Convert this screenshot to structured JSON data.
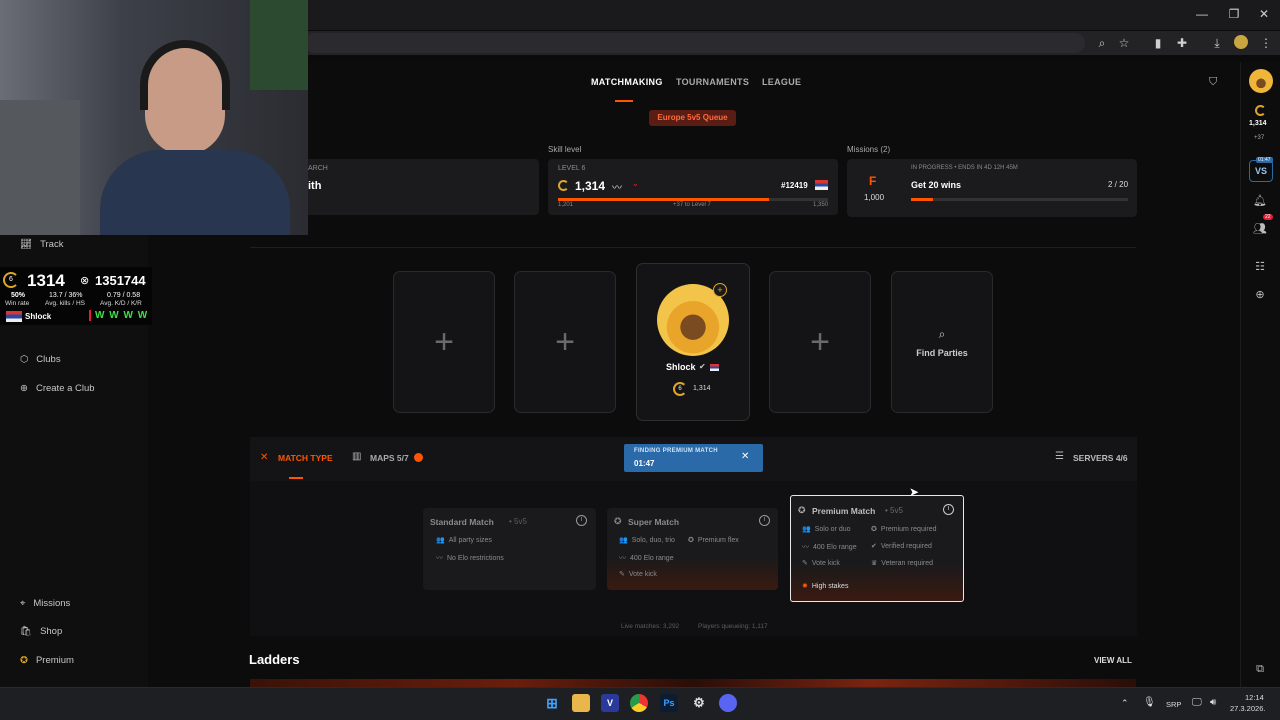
{
  "header": {
    "tabs": [
      "MATCHMAKING",
      "TOURNAMENTS",
      "LEAGUE"
    ],
    "queue_badge": "Europe 5v5 Queue"
  },
  "stats": {
    "search_label": "ARCH",
    "search_value": "ith",
    "skill": {
      "title": "Skill level",
      "level": "LEVEL 6",
      "elo": "1,314",
      "rank": "#12419",
      "min": "1,201",
      "to_next": "+37 to Level 7",
      "max": "1,350",
      "progress": 0.78
    },
    "missions": {
      "title": "Missions (2)",
      "letter": "F",
      "points": "1,000",
      "status": "IN PROGRESS • ENDS IN 4D 12H 45M",
      "name": "Get 20 wins",
      "count": "2 / 20",
      "progress": 0.1
    }
  },
  "sidebar": {
    "track": "Track",
    "clubs": "Clubs",
    "create_club": "Create a Club",
    "missions": "Missions",
    "shop": "Shop",
    "premium": "Premium"
  },
  "overlay": {
    "elo": "1314",
    "level": "6",
    "points": "1351744",
    "winrate": "50%",
    "winrate_label": "Win rate",
    "kills": "13.7 / 36%",
    "kills_label": "Avg. kills / HS",
    "kd": "0.79 / 0.58",
    "kd_label": "Avg. K/D / K/R",
    "name": "Shlock",
    "streak": [
      "W",
      "W",
      "W",
      "W"
    ]
  },
  "party": {
    "player_name": "Shlock",
    "player_elo": "1,314",
    "player_level": "6",
    "find_parties": "Find Parties"
  },
  "match_bar": {
    "match_type": "MATCH TYPE",
    "maps": "MAPS 5/7",
    "finding_label": "FINDING PREMIUM MATCH",
    "timer": "01:47",
    "servers": "SERVERS 4/6"
  },
  "match_types": [
    {
      "name": "Standard Match",
      "mode": "• 5v5",
      "lines": [
        "All party sizes",
        "No Elo restrictions"
      ]
    },
    {
      "name": "Super Match",
      "mode": "• 5v5",
      "lines": [
        "Solo, duo, trio",
        "Premium flex",
        "400 Elo range",
        "Vote kick"
      ]
    },
    {
      "name": "Premium Match",
      "mode": "• 5v5",
      "lines": [
        "Solo or duo",
        "Premium required",
        "400 Elo range",
        "Verified required",
        "Vote kick",
        "Veteran required"
      ],
      "tag": "High stakes"
    }
  ],
  "footer": {
    "live": "Live matches: 3,292",
    "queueing": "Players queueing: 1,117",
    "ladders": "Ladders",
    "view_all": "VIEW ALL"
  },
  "right_sidebar": {
    "points": "1,314",
    "delta": "+37",
    "vs_time": "01:47",
    "notif": "22"
  },
  "taskbar": {
    "lang": "SRP",
    "time": "12:14",
    "date": "27.3.2026."
  },
  "colors": {
    "accent": "#ff5500",
    "badge_bg": "#5a1d14",
    "finding_bg": "#2b6aa8"
  }
}
